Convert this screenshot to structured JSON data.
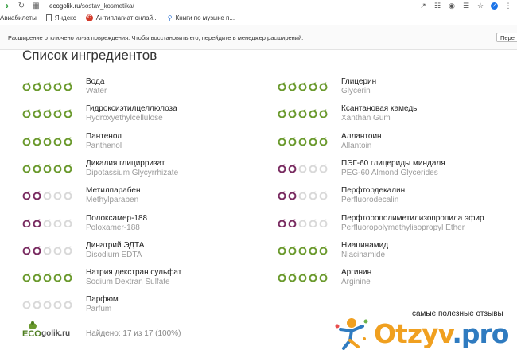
{
  "browser": {
    "url_host": "ecogolik.ru",
    "url_path": "/sostav_kosmetika/",
    "bookmarks": [
      {
        "label": "Авиабилеты",
        "icon": "plane-icon"
      },
      {
        "label": "Яндекс",
        "icon": "document-icon"
      },
      {
        "label": "Антиплагиат онлай...",
        "icon": "antiplagiat-icon"
      },
      {
        "label": "Книги по музыке п...",
        "icon": "search-icon"
      }
    ],
    "notice_text": "Расширение отключено из-за повреждения. Чтобы восстановить его, перейдите в менеджер расширений.",
    "notice_button": "Пере"
  },
  "page": {
    "title": "Список ингредиентов",
    "found_text": "Найдено: 17 из 17 (100%)",
    "logo_eco": "ECO",
    "logo_golik": "golik.ru"
  },
  "rating_colors": {
    "green": "#6b9a2e",
    "purple": "#7a2d62",
    "empty": "#d9d9d9"
  },
  "ingredients_left": [
    {
      "ru": "Вода",
      "en": "Water",
      "rating": 5,
      "color": "green"
    },
    {
      "ru": "Гидроксиэтилцеллюлоза",
      "en": "Hydroxyethylcellulose",
      "rating": 5,
      "color": "green"
    },
    {
      "ru": "Пантенол",
      "en": "Panthenol",
      "rating": 5,
      "color": "green"
    },
    {
      "ru": "Дикалия глицирризат",
      "en": "Dipotassium Glycyrrhizate",
      "rating": 5,
      "color": "green"
    },
    {
      "ru": "Метилпарабен",
      "en": "Methylparaben",
      "rating": 2,
      "color": "purple"
    },
    {
      "ru": "Полоксамер-188",
      "en": "Poloxamer-188",
      "rating": 2,
      "color": "purple"
    },
    {
      "ru": "Динатрий ЭДТА",
      "en": "Disodium EDTA",
      "rating": 2,
      "color": "purple"
    },
    {
      "ru": "Натрия декстран сульфат",
      "en": "Sodium Dextran Sulfate",
      "rating": 5,
      "color": "green"
    },
    {
      "ru": "Парфюм",
      "en": "Parfum",
      "rating": 0,
      "color": "empty"
    }
  ],
  "ingredients_right": [
    {
      "ru": "Глицерин",
      "en": "Glycerin",
      "rating": 5,
      "color": "green"
    },
    {
      "ru": "Ксантановая камедь",
      "en": "Xanthan Gum",
      "rating": 5,
      "color": "green"
    },
    {
      "ru": "Аллантоин",
      "en": "Allantoin",
      "rating": 5,
      "color": "green"
    },
    {
      "ru": "ПЭГ-60 глицериды миндаля",
      "en": "PEG-60 Almond Glycerides",
      "rating": 2,
      "color": "purple"
    },
    {
      "ru": "Перфтордекалин",
      "en": "Perfluorodecalin",
      "rating": 2,
      "color": "purple"
    },
    {
      "ru": "Перфторополиметилизопропила эфир",
      "en": "Perfluoropolymethylisopropyl Ether",
      "rating": 2,
      "color": "purple"
    },
    {
      "ru": "Ниацинамид",
      "en": "Niacinamide",
      "rating": 5,
      "color": "green"
    },
    {
      "ru": "Аргинин",
      "en": "Arginine",
      "rating": 5,
      "color": "green"
    }
  ],
  "watermark": {
    "caption": "самые полезные отзывы",
    "logo_main": "Otzyv",
    "logo_tld": ".pro"
  }
}
